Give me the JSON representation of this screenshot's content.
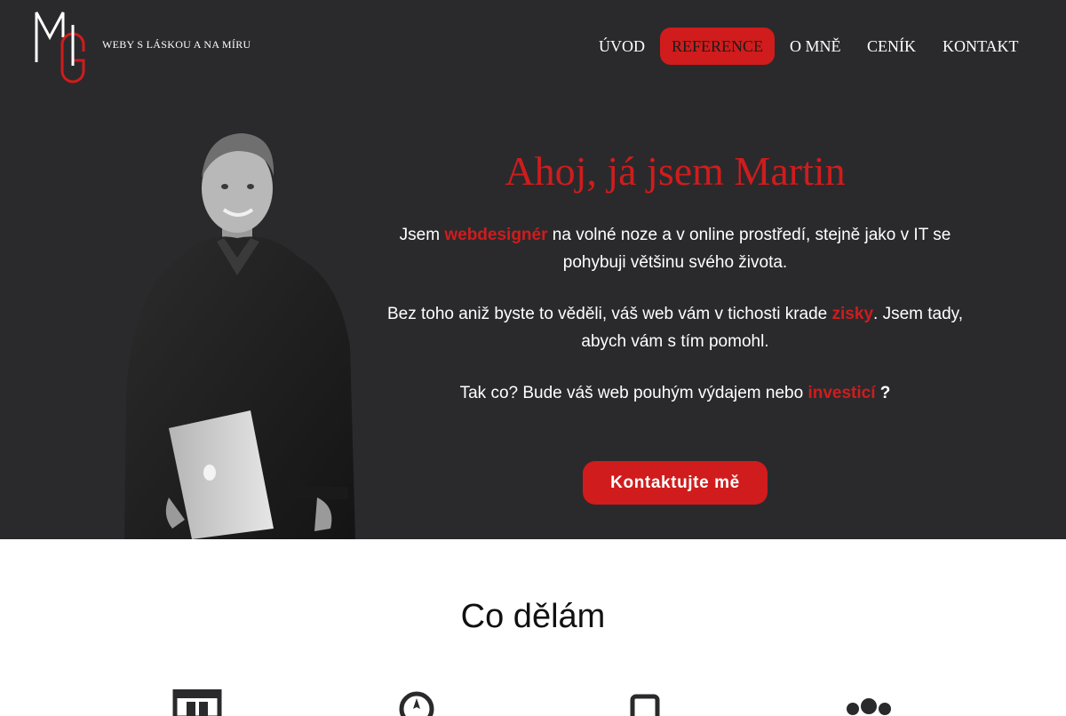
{
  "header": {
    "logo_alt": "MG logo",
    "tagline": "WEBY S LÁSKOU A NA MÍRU",
    "nav": [
      {
        "label": "ÚVOD",
        "active": false
      },
      {
        "label": "REFERENCE",
        "active": true
      },
      {
        "label": "O MNĚ",
        "active": false
      },
      {
        "label": "CENÍK",
        "active": false
      },
      {
        "label": "KONTAKT",
        "active": false
      }
    ]
  },
  "hero": {
    "title": "Ahoj, já jsem Martin",
    "p1": {
      "a": "Jsem ",
      "hl": "webdesignér",
      "b": " na volné noze a v online prostředí, stejně jako v IT se pohybuji většinu svého života."
    },
    "p2": {
      "a": "Bez toho aniž byste to věděli, váš web vám v tichosti krade ",
      "hl": "zisky",
      "b": ". Jsem tady, abych vám s tím pomohl."
    },
    "p3": {
      "a": "Tak co? Bude váš web pouhým výdajem nebo ",
      "hl": "investicí",
      "b": " ?"
    },
    "cta": "Kontaktujte mě"
  },
  "services": {
    "title": "Co dělám",
    "icons": [
      "browser-icon",
      "compass-icon",
      "mobile-icon",
      "people-icon"
    ]
  },
  "colors": {
    "accent": "#d01c1c",
    "hero_bg": "#2a2a2d",
    "text_light": "#ffffff"
  }
}
